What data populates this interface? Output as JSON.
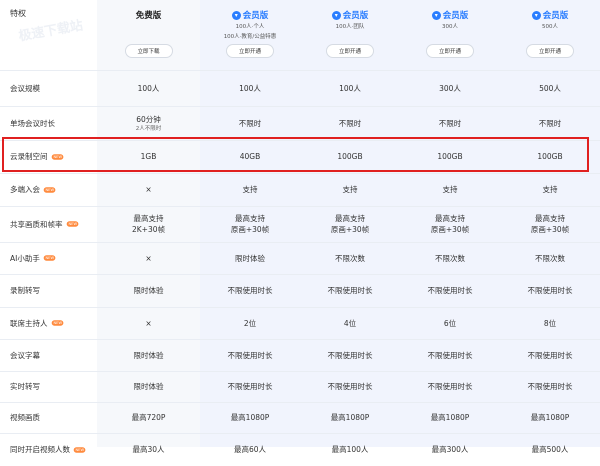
{
  "header": {
    "feature_title": "特权",
    "watermark": "极速下载站",
    "plans": [
      {
        "name": "免费版",
        "vip": false,
        "sub1": "",
        "sub2": "",
        "button": "立即下载"
      },
      {
        "name": "会员版",
        "vip": true,
        "sub1": "100人·个人",
        "sub2": "100人·教育/公益特惠",
        "button": "立即开通"
      },
      {
        "name": "会员版",
        "vip": true,
        "sub1": "100人·团队",
        "sub2": "",
        "button": "立即开通"
      },
      {
        "name": "会员版",
        "vip": true,
        "sub1": "300人",
        "sub2": "",
        "button": "立即开通"
      },
      {
        "name": "会员版",
        "vip": true,
        "sub1": "500人",
        "sub2": "",
        "button": "立即开通"
      }
    ]
  },
  "new_badge": "NEW",
  "rows": [
    {
      "label": "会议规模",
      "new": false,
      "cells": [
        "100人",
        "100人",
        "100人",
        "300人",
        "500人"
      ],
      "sub": [
        "",
        "",
        "",
        "",
        ""
      ]
    },
    {
      "label": "单场会议时长",
      "new": false,
      "cells": [
        "60分钟",
        "不限时",
        "不限时",
        "不限时",
        "不限时"
      ],
      "sub": [
        "2人不限时",
        "",
        "",
        "",
        ""
      ]
    },
    {
      "label": "云录制空间",
      "new": true,
      "cells": [
        "1GB",
        "40GB",
        "100GB",
        "100GB",
        "100GB"
      ],
      "sub": [
        "",
        "",
        "",
        "",
        ""
      ]
    },
    {
      "label": "多端入会",
      "new": true,
      "cells": [
        "×",
        "支持",
        "支持",
        "支持",
        "支持"
      ],
      "sub": [
        "",
        "",
        "",
        "",
        ""
      ]
    },
    {
      "label": "共享画质和帧率",
      "new": true,
      "cells": [
        "最高支持",
        "最高支持",
        "最高支持",
        "最高支持",
        "最高支持"
      ],
      "sub": [
        "2K+30帧",
        "原画+30帧",
        "原画+30帧",
        "原画+30帧",
        "原画+30帧"
      ]
    },
    {
      "label": "AI小助手",
      "new": true,
      "cells": [
        "×",
        "限时体验",
        "不限次数",
        "不限次数",
        "不限次数"
      ],
      "sub": [
        "",
        "",
        "",
        "",
        ""
      ]
    },
    {
      "label": "录制转写",
      "new": false,
      "cells": [
        "限时体验",
        "不限使用时长",
        "不限使用时长",
        "不限使用时长",
        "不限使用时长"
      ],
      "sub": [
        "",
        "",
        "",
        "",
        ""
      ]
    },
    {
      "label": "联席主持人",
      "new": true,
      "cells": [
        "×",
        "2位",
        "4位",
        "6位",
        "8位"
      ],
      "sub": [
        "",
        "",
        "",
        "",
        ""
      ]
    },
    {
      "label": "会议字幕",
      "new": false,
      "cells": [
        "限时体验",
        "不限使用时长",
        "不限使用时长",
        "不限使用时长",
        "不限使用时长"
      ],
      "sub": [
        "",
        "",
        "",
        "",
        ""
      ]
    },
    {
      "label": "实时转写",
      "new": false,
      "cells": [
        "限时体验",
        "不限使用时长",
        "不限使用时长",
        "不限使用时长",
        "不限使用时长"
      ],
      "sub": [
        "",
        "",
        "",
        "",
        ""
      ]
    },
    {
      "label": "视频画质",
      "new": false,
      "cells": [
        "最高720P",
        "最高1080P",
        "最高1080P",
        "最高1080P",
        "最高1080P"
      ],
      "sub": [
        "",
        "",
        "",
        "",
        ""
      ]
    },
    {
      "label": "同时开启视频人数",
      "new": true,
      "cells": [
        "最高30人",
        "最高60人",
        "最高100人",
        "最高300人",
        "最高500人"
      ],
      "sub": [
        "",
        "",
        "",
        "",
        ""
      ]
    }
  ],
  "colors": {
    "accent": "#2a7dff",
    "highlight_border": "#e02020",
    "new_badge": "#ff8a3d",
    "free_col_bg": "#f6f8fb",
    "vip_col_bg": "#f1f4fd"
  }
}
